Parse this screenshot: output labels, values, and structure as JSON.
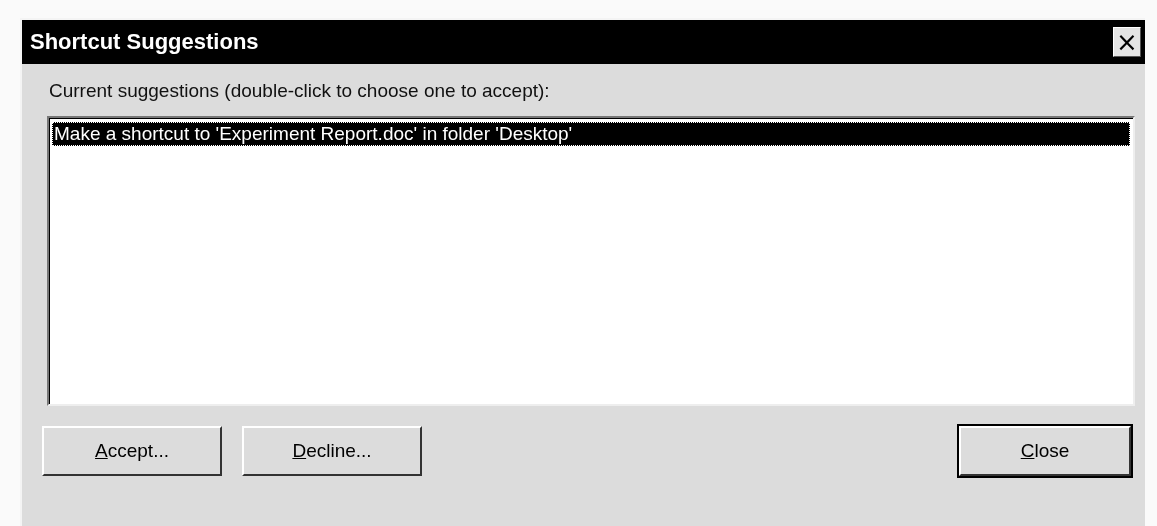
{
  "window": {
    "title": "Shortcut Suggestions",
    "close_glyph": "×"
  },
  "label": "Current suggestions (double-click to choose one to accept):",
  "suggestions": [
    {
      "text": "Make a shortcut to 'Experiment Report.doc' in folder 'Desktop'",
      "selected": true
    }
  ],
  "buttons": [
    {
      "label": "Accept...",
      "default": false
    },
    {
      "label": "Decline...",
      "default": false
    },
    {
      "label": "Close",
      "default": true
    }
  ]
}
